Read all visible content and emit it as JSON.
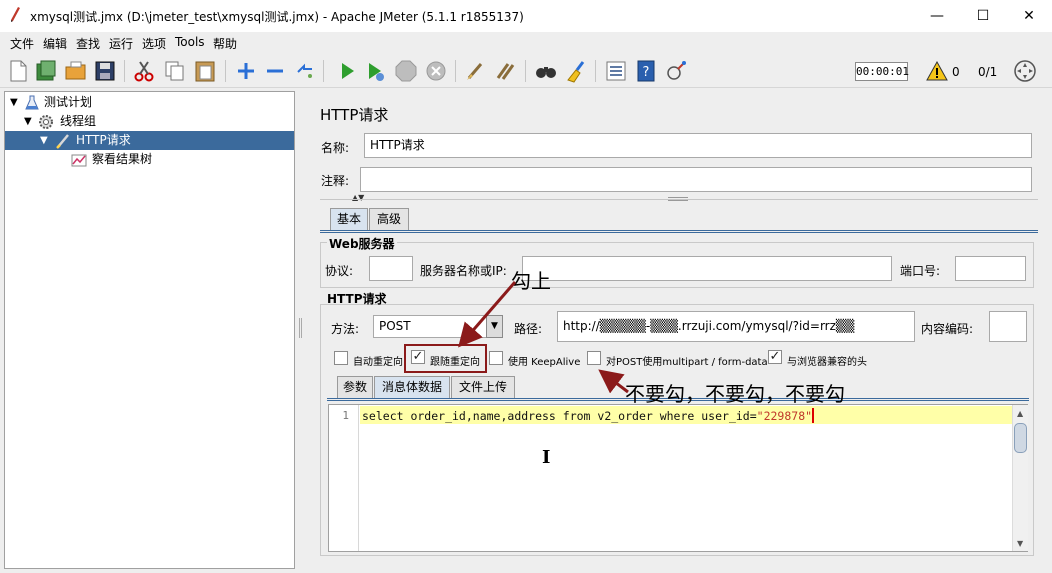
{
  "window": {
    "title": "xmysql测试.jmx (D:\\jmeter_test\\xmysql测试.jmx) - Apache JMeter (5.1.1 r1855137)",
    "minimize": "—",
    "maximize": "☐",
    "close": "✕"
  },
  "menu": [
    "文件",
    "编辑",
    "查找",
    "运行",
    "选项",
    "Tools",
    "帮助"
  ],
  "toolbar": {
    "icons": [
      "new-icon",
      "templates-icon",
      "open-icon",
      "save-icon",
      "cut-icon",
      "copy-icon",
      "paste-icon",
      "expand-icon",
      "collapse-icon",
      "toggle-icon",
      "start-icon",
      "start-no-pause-icon",
      "stop-icon",
      "shutdown-icon",
      "clear-icon",
      "clear-all-icon",
      "search-icon",
      "reset-search-icon",
      "function-helper-icon",
      "help-icon",
      "remote-icon"
    ],
    "timer": "00:00:01",
    "warning_count": "0",
    "thread_count": "0/1"
  },
  "tree": {
    "items": [
      {
        "label": "测试计划",
        "icon": "test-plan-icon"
      },
      {
        "label": "线程组",
        "icon": "thread-group-icon"
      },
      {
        "label": "HTTP请求",
        "icon": "sampler-icon"
      },
      {
        "label": "察看结果树",
        "icon": "listener-icon"
      }
    ]
  },
  "panel": {
    "heading": "HTTP请求",
    "name_label": "名称:",
    "name_value": "HTTP请求",
    "comment_label": "注释:",
    "comment_value": "",
    "tabs": [
      "基本",
      "高级"
    ],
    "web_server": {
      "title": "Web服务器",
      "protocol_label": "协议:",
      "protocol_value": "",
      "server_label": "服务器名称或IP:",
      "server_value": "",
      "port_label": "端口号:",
      "port_value": ""
    },
    "http_request": {
      "title": "HTTP请求",
      "method_label": "方法:",
      "method_value": "POST",
      "path_label": "路径:",
      "path_value": "http://▒▒▒▒▒-▒▒▒.rrzuji.com/ymysql/?id=rrz▒▒",
      "encoding_label": "内容编码:",
      "encoding_value": ""
    },
    "options": [
      {
        "label": "自动重定向",
        "checked": false
      },
      {
        "label": "跟随重定向",
        "checked": true
      },
      {
        "label": "使用 KeepAlive",
        "checked": false
      },
      {
        "label": "对POST使用multipart / form-data",
        "checked": false
      },
      {
        "label": "与浏览器兼容的头",
        "checked": true
      }
    ],
    "subtabs": [
      "参数",
      "消息体数据",
      "文件上传"
    ],
    "body": {
      "line_number": "1",
      "code_prefix": "select order_id,name,address from v2_order where user_id=",
      "code_string": "\"229878\""
    }
  },
  "annotations": {
    "check_on": "勾上",
    "do_not_check": "不要勾，不要勾，不要勾"
  }
}
